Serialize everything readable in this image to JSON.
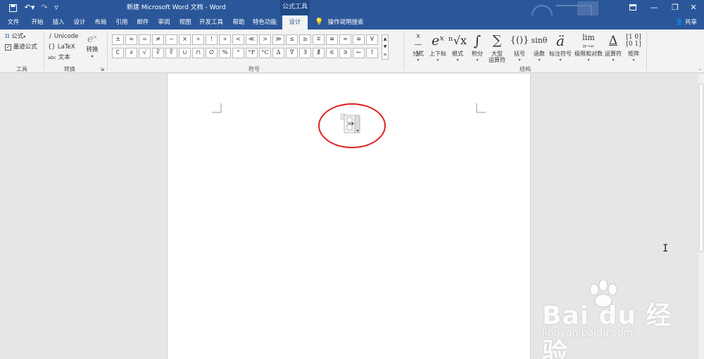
{
  "titlebar": {
    "doc_title": "新建 Microsoft Word 文档 - Word",
    "context_tool": "公式工具",
    "undo_icon": "undo-icon",
    "redo_icon": "redo-icon"
  },
  "tabs": [
    "文件",
    "开始",
    "插入",
    "设计",
    "布局",
    "引用",
    "邮件",
    "审阅",
    "视图",
    "开发工具",
    "帮助",
    "特色功能",
    "设计"
  ],
  "tell_me": "操作说明搜索",
  "share": "共享",
  "tools_group": {
    "equation": "公式",
    "ink_equation": "墨迹公式",
    "label": "工具"
  },
  "convert_group": {
    "unicode": "Unicode",
    "latex": "LaTeX",
    "text": "文本",
    "text_prefix": "abc",
    "convert": "转换",
    "label": "转换"
  },
  "symbols_group": {
    "row1": [
      "±",
      "∞",
      "=",
      "≠",
      "~",
      "×",
      "÷",
      "!",
      "∝",
      "<",
      "≪",
      ">",
      "≫",
      "≤",
      "≥",
      "∓",
      "≅",
      "≈",
      "≡",
      "∀"
    ],
    "row2": [
      "∁",
      "∂",
      "√",
      "∛",
      "∜",
      "∪",
      "∩",
      "∅",
      "%",
      "°",
      "°F",
      "°C",
      "∆",
      "∇",
      "∃",
      "∄",
      "∈",
      "∋",
      "←",
      "↑"
    ],
    "label": "符号"
  },
  "structures_group": {
    "items": [
      {
        "icon": "x/y",
        "label": "分式"
      },
      {
        "icon": "eˣ",
        "label": "上下标"
      },
      {
        "icon": "ⁿ√x",
        "label": "根式"
      },
      {
        "icon": "∫",
        "label": "积分"
      },
      {
        "icon": "∑",
        "label": "大型\n运算符"
      },
      {
        "icon": "{()}",
        "label": "括号"
      },
      {
        "icon": "sinθ",
        "label": "函数"
      },
      {
        "icon": "ä",
        "label": "标注符号"
      },
      {
        "icon": "lim",
        "label": "极限和对数"
      },
      {
        "icon": "Δ",
        "label": "运算符"
      },
      {
        "icon": "[10]",
        "label": "矩阵"
      }
    ],
    "label": "结构"
  },
  "watermark": {
    "main": "Bai du 经验",
    "sub": "jingyan.baidu.com"
  },
  "colors": {
    "accent": "#2b579a",
    "annotation": "#e02020"
  }
}
